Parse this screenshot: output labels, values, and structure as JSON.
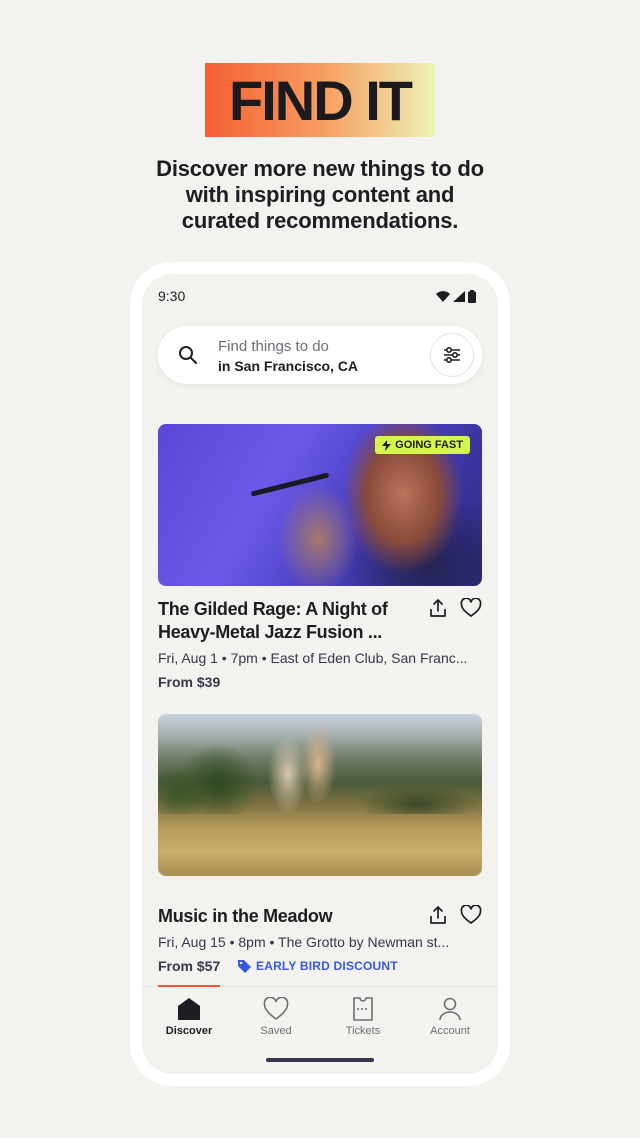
{
  "hero": {
    "title": "FIND IT",
    "subtitle_line1": "Discover more new things to do",
    "subtitle_line2": "with inspiring content and",
    "subtitle_line3": "curated recommendations."
  },
  "status_bar": {
    "time": "9:30",
    "icons": [
      "wifi-icon",
      "signal-icon",
      "battery-icon"
    ]
  },
  "search": {
    "placeholder": "Find things to do",
    "location": "in San Francisco, CA",
    "icons": [
      "search-icon",
      "filter-icon"
    ]
  },
  "events": [
    {
      "title_line1": "The Gilded Rage: A Night of",
      "title_line2": "Heavy-Metal Jazz Fusion ...",
      "meta": "Fri, Aug 1 • 7pm • East of Eden Club, San Franc...",
      "price": "From $39",
      "badge": "GOING FAST"
    },
    {
      "title_line1": "Music in the Meadow",
      "meta": "Fri, Aug 15 • 8pm • The Grotto by Newman st...",
      "price": "From $57",
      "promo": "EARLY BIRD DISCOUNT"
    }
  ],
  "tabs": [
    {
      "label": "Discover",
      "icon": "home-icon",
      "active": true
    },
    {
      "label": "Saved",
      "icon": "heart-icon",
      "active": false
    },
    {
      "label": "Tickets",
      "icon": "ticket-icon",
      "active": false
    },
    {
      "label": "Account",
      "icon": "person-icon",
      "active": false
    }
  ],
  "colors": {
    "accent": "#f05537",
    "badge": "#d4f54d",
    "promo": "#3659e3",
    "background": "#f3f2ee"
  }
}
